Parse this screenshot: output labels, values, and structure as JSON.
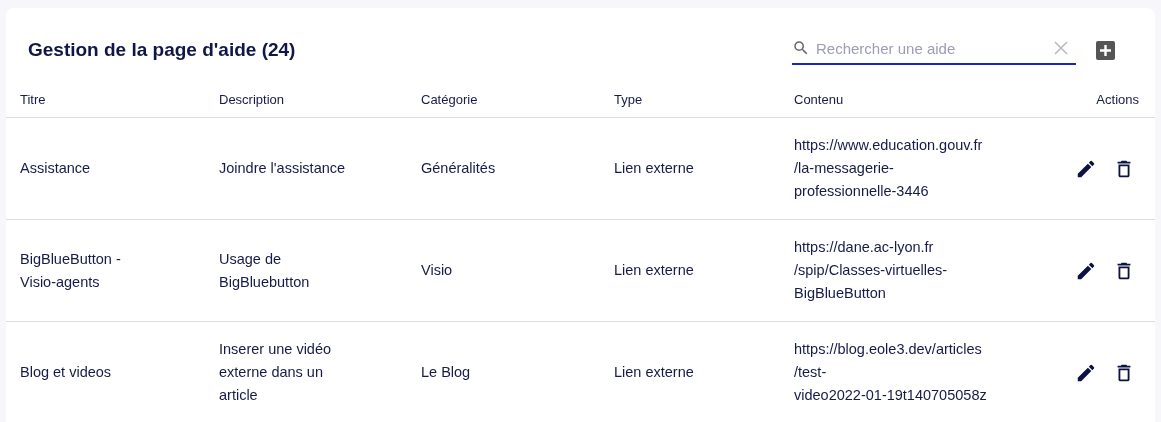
{
  "header": {
    "title": "Gestion de la page d'aide (24)",
    "search": {
      "placeholder": "Rechercher une aide"
    }
  },
  "table": {
    "columns": [
      "Titre",
      "Description",
      "Catégorie",
      "Type",
      "Contenu",
      "Actions"
    ],
    "rows": [
      {
        "title": "Assistance",
        "description": "Joindre l'assistance",
        "category": "Généralités",
        "type": "Lien externe",
        "content": "https://www.education.gouv.fr\n/la-messagerie-\nprofessionnelle-3446"
      },
      {
        "title": "BigBlueButton -\nVisio-agents",
        "description": "Usage de\nBigBluebutton",
        "category": "Visio",
        "type": "Lien externe",
        "content": "https://dane.ac-lyon.fr\n/spip/Classes-virtuelles-\nBigBlueButton"
      },
      {
        "title": "Blog et videos",
        "description": "Inserer une vidéo\nexterne dans un\narticle",
        "category": "Le Blog",
        "type": "Lien externe",
        "content": "https://blog.eole3.dev/articles\n/test-\nvideo2022-01-19t140705058z"
      }
    ]
  }
}
